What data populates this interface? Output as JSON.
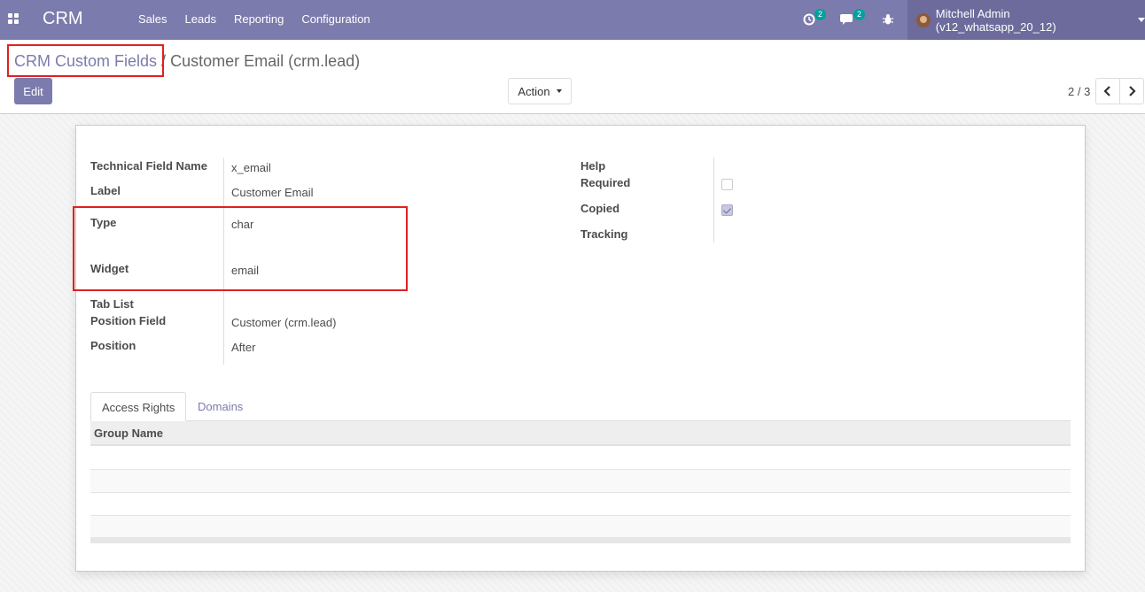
{
  "navbar": {
    "app_name": "CRM",
    "menu_items": [
      "Sales",
      "Leads",
      "Reporting",
      "Configuration"
    ],
    "activity_count": "2",
    "messages_count": "2",
    "user_name": "Mitchell Admin (v12_whatsapp_20_12)",
    "accent_color": "#7c7bad"
  },
  "breadcrumb": {
    "parent": "CRM Custom Fields",
    "separator": "/",
    "current": "Customer Email (crm.lead)"
  },
  "toolbar": {
    "edit_label": "Edit",
    "action_label": "Action"
  },
  "pager": {
    "value": "2 / 3"
  },
  "form": {
    "left": [
      {
        "label": "Technical Field Name",
        "value": "x_email"
      },
      {
        "label": "Label",
        "value": "Customer Email"
      },
      {
        "label": "Type",
        "value": "char"
      },
      {
        "label": "Widget",
        "value": "email"
      },
      {
        "label": "Tab List",
        "value": ""
      },
      {
        "label": "Position Field",
        "value": "Customer (crm.lead)"
      },
      {
        "label": "Position",
        "value": "After"
      }
    ],
    "right": [
      {
        "label": "Help",
        "checked": null
      },
      {
        "label": "Required",
        "checked": false
      },
      {
        "label": "Copied",
        "checked": true
      },
      {
        "label": "Tracking",
        "checked": null
      }
    ]
  },
  "tabs": [
    {
      "label": "Access Rights",
      "active": true
    },
    {
      "label": "Domains",
      "active": false
    }
  ],
  "access_table": {
    "columns": [
      "Group Name"
    ],
    "rows": []
  }
}
